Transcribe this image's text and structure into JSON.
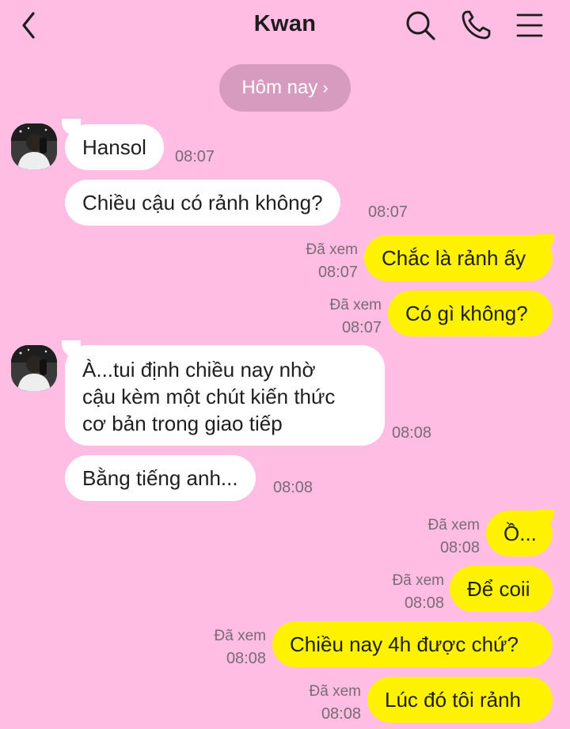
{
  "header": {
    "title": "Kwan"
  },
  "date_pill": {
    "label": "Hôm nay",
    "chevron": "›"
  },
  "messages": [
    {
      "from": "them",
      "text": "Hansol",
      "time": "08:07"
    },
    {
      "from": "them",
      "text": "Chiều cậu có rảnh không?",
      "time": "08:07"
    },
    {
      "from": "me",
      "text": "Chắc là rảnh ấy",
      "status": "Đã xem",
      "time": "08:07"
    },
    {
      "from": "me",
      "text": "Có gì không?",
      "status": "Đã xem",
      "time": "08:07"
    },
    {
      "from": "them",
      "lines": [
        "À...tui định chiều nay nhờ",
        "cậu kèm một chút kiến thức",
        "cơ bản trong giao tiếp"
      ],
      "time": "08:08"
    },
    {
      "from": "them",
      "text": "Bằng tiếng anh...",
      "time": "08:08"
    },
    {
      "from": "me",
      "text": "Ồ...",
      "status": "Đã xem",
      "time": "08:08"
    },
    {
      "from": "me",
      "text": "Để coii",
      "status": "Đã xem",
      "time": "08:08"
    },
    {
      "from": "me",
      "text": "Chiều nay 4h được chứ?",
      "status": "Đã xem",
      "time": "08:08"
    },
    {
      "from": "me",
      "text": "Lúc đó tôi rảnh",
      "status": "Đã xem",
      "time": "08:08"
    }
  ],
  "colors": {
    "background": "#ffbde3",
    "incoming_bubble": "#ffffff",
    "outgoing_bubble": "#fff200",
    "date_pill": "#d89bc0"
  },
  "icons": [
    "back-chevron-icon",
    "search-icon",
    "phone-icon",
    "menu-icon"
  ]
}
